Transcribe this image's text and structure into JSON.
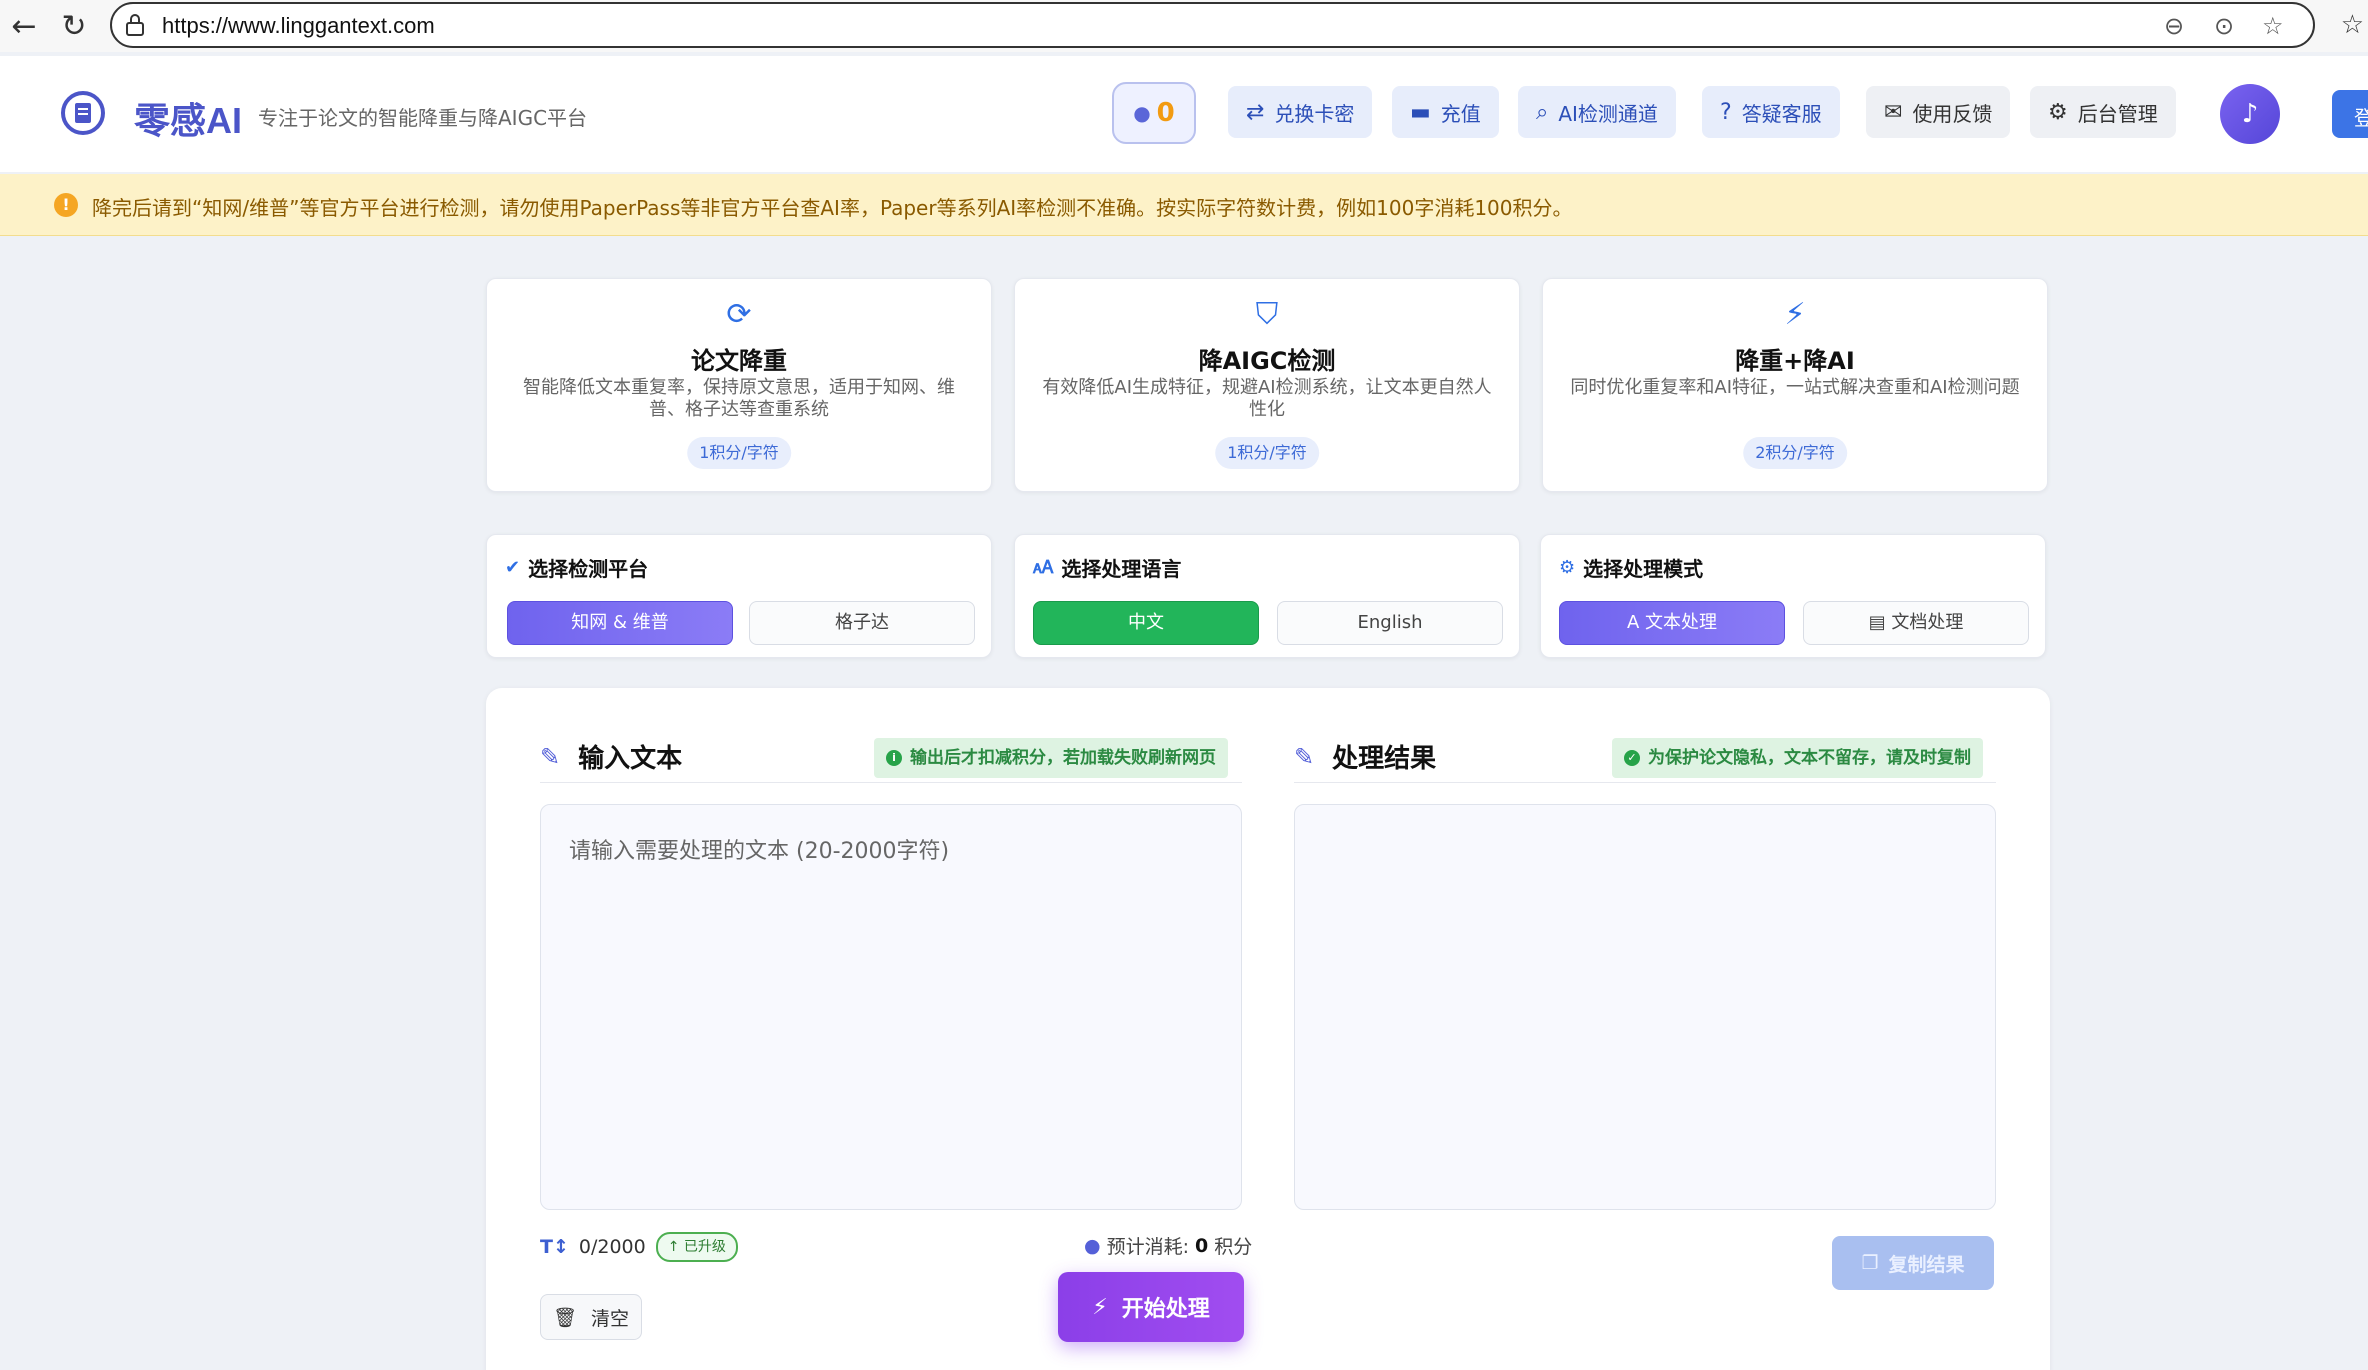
{
  "browser": {
    "url": "https://www.linggantext.com"
  },
  "header": {
    "brand": "零感AI",
    "tagline": "专注于论文的智能降重与降AIGC平台",
    "credits": "0",
    "buttons": {
      "redeem": "兑换卡密",
      "recharge": "充值",
      "ai_detect": "AI检测通道",
      "support": "答疑客服",
      "feedback": "使用反馈",
      "admin": "后台管理"
    },
    "login": "登"
  },
  "notice": {
    "text": "降完后请到“知网/维普”等官方平台进行检测，请勿使用PaperPass等非官方平台查AI率，Paper等系列AI率检测不准确。按实际字符数计费，例如100字消耗100积分。"
  },
  "features": [
    {
      "title": "论文降重",
      "desc": "智能降低文本重复率，保持原文意思，适用于知网、维普、格子达等查重系统",
      "price": "1积分/字符"
    },
    {
      "title": "降AIGC检测",
      "desc": "有效降低AI生成特征，规避AI检测系统，让文本更自然人性化",
      "price": "1积分/字符"
    },
    {
      "title": "降重+降AI",
      "desc": "同时优化重复率和AI特征，一站式解决查重和AI检测问题",
      "price": "2积分/字符"
    }
  ],
  "options": {
    "platform": {
      "title": "选择检测平台",
      "choices": [
        "知网 & 维普",
        "格子达"
      ]
    },
    "language": {
      "title": "选择处理语言",
      "choices": [
        "中文",
        "English"
      ]
    },
    "mode": {
      "title": "选择处理模式",
      "choices": [
        "文本处理",
        "文档处理"
      ]
    }
  },
  "input": {
    "title": "输入文本",
    "note": "输出后才扣减积分，若加载失败刷新网页",
    "placeholder": "请输入需要处理的文本 (20-2000字符)",
    "counter": "0/2000",
    "upgraded": "已升级",
    "estimate_prefix": "预计消耗:",
    "estimate_value": "0",
    "estimate_unit": "积分",
    "clear": "清空",
    "start": "开始处理"
  },
  "output": {
    "title": "处理结果",
    "note": "为保护论文隐私，文本不留存，请及时复制",
    "copy": "复制结果"
  },
  "colors": {
    "brand": "#4b55c8",
    "accent_purple": "#8b3fe8",
    "accent_green": "#22b55a",
    "notice_bg": "#fdf2c8"
  }
}
